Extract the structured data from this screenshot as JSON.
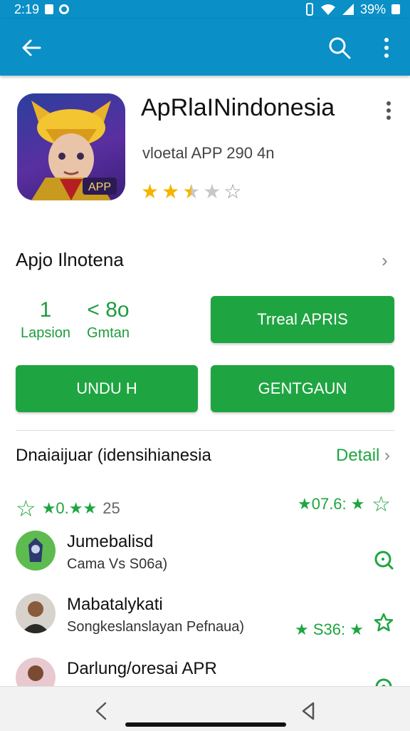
{
  "status_bar": {
    "time": "2:19",
    "battery": "39%"
  },
  "app_bar": {
    "back_icon": "arrow-back-icon",
    "search_icon": "search-icon",
    "more_icon": "more-vert-icon",
    "color": "#0a8fc6"
  },
  "app": {
    "title": "ApRlaINindonesia",
    "subtitle": "vloetal APP 290 4n",
    "icon_badge": "APP",
    "rating_stars": 2.5
  },
  "section": {
    "title": "Apjo Ilnotena"
  },
  "stats": [
    {
      "value": "1",
      "label": "Lapsion"
    },
    {
      "value": "< 8o",
      "label": "Gmtan"
    }
  ],
  "buttons": {
    "primary": "Trreal APRIS",
    "download": "UNDU H",
    "secondary": "GENTGAUN"
  },
  "detail": {
    "title": "Dnaiaijuar (idensihianesia",
    "link": "Detail"
  },
  "rating_summary": {
    "left_text": "★0.★★",
    "left_count": "25",
    "right_text": "★07.6: ★"
  },
  "reviews": [
    {
      "name": "Jumebalisd",
      "text": "Cama Vs S06a)",
      "rating": "",
      "icon": "search-circle-icon"
    },
    {
      "name": "Mabatalykati",
      "text": "Songkeslanslayan Pefnaua)",
      "rating": "★ S36: ★",
      "icon": "outline-star-icon"
    },
    {
      "name": "Darlung/oresai APR",
      "text": "",
      "rating": "",
      "icon": "circle-dot-icon"
    }
  ],
  "accent": "#1ea541"
}
